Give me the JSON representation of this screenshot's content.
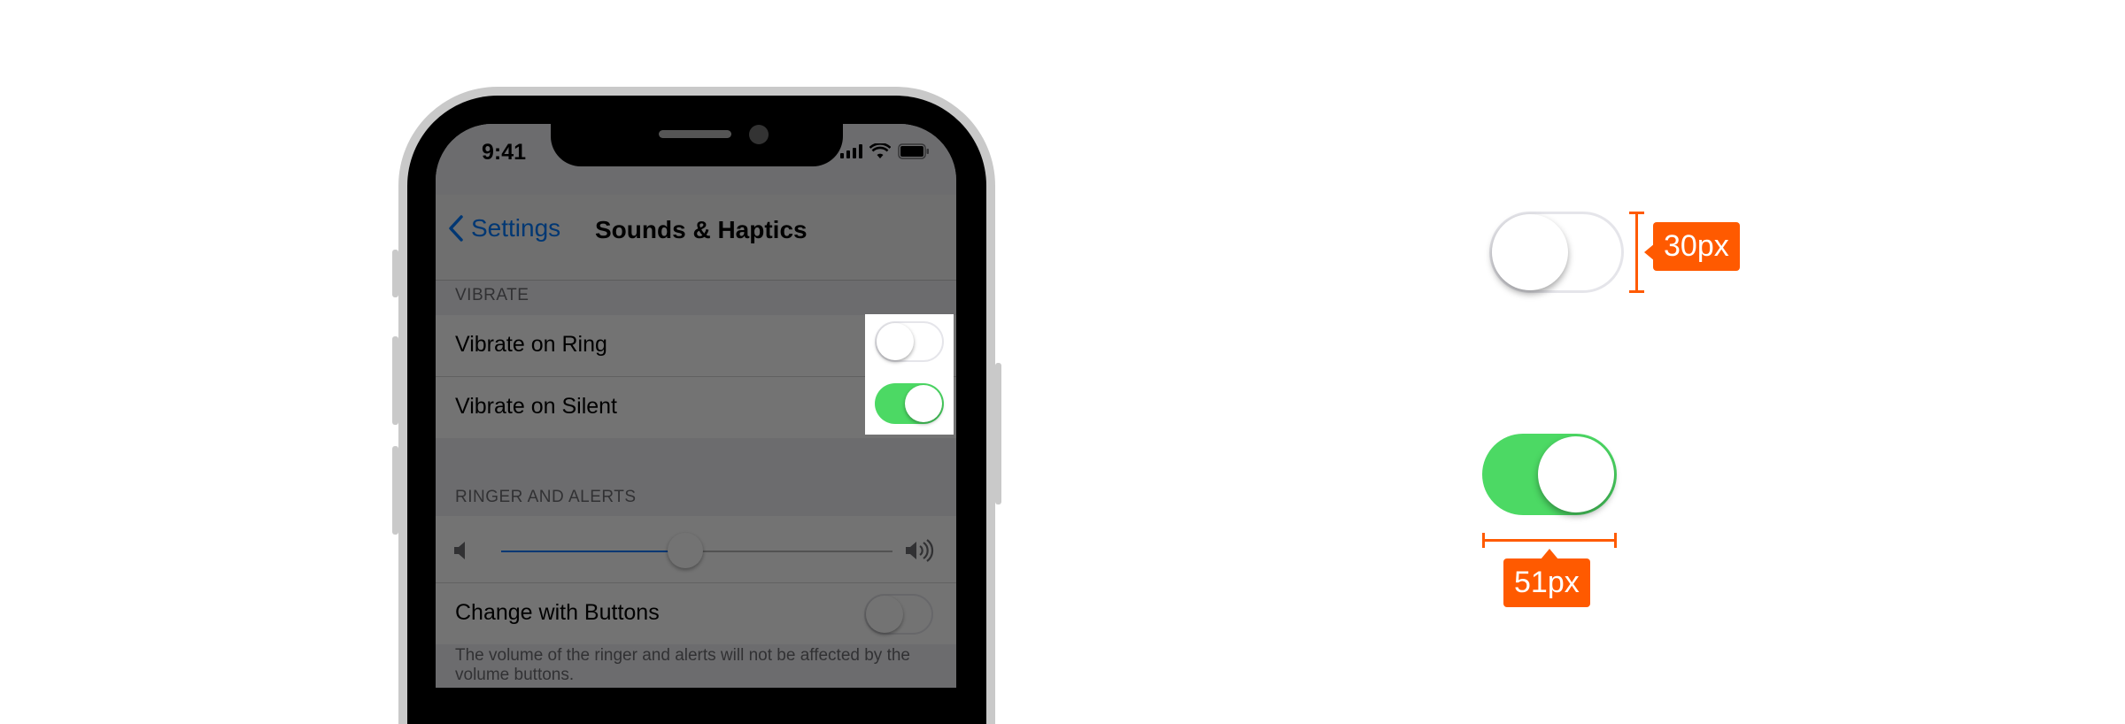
{
  "status_bar": {
    "time": "9:41"
  },
  "navbar": {
    "back_label": "Settings",
    "title": "Sounds & Haptics"
  },
  "sections": {
    "vibrate_header": "VIBRATE",
    "ringer_header": "RINGER AND ALERTS"
  },
  "cells": {
    "vibrate_on_ring": {
      "label": "Vibrate on Ring",
      "state": "off"
    },
    "vibrate_on_silent": {
      "label": "Vibrate on Silent",
      "state": "on"
    },
    "change_with_buttons": {
      "label": "Change with Buttons",
      "state": "off"
    }
  },
  "volume_slider": {
    "level": 0.47
  },
  "footer_note": "The volume of the ringer and alerts will not be affected by the volume buttons.",
  "annotations": {
    "height_label": "30px",
    "width_label": "51px"
  },
  "colors": {
    "tint": "#007aff",
    "toggle_on": "#4cd964",
    "annotation": "#ff5a00"
  },
  "icons": [
    "chevron-left-icon",
    "signal-icon",
    "wifi-icon",
    "battery-icon",
    "speaker-low-icon",
    "speaker-high-icon"
  ]
}
